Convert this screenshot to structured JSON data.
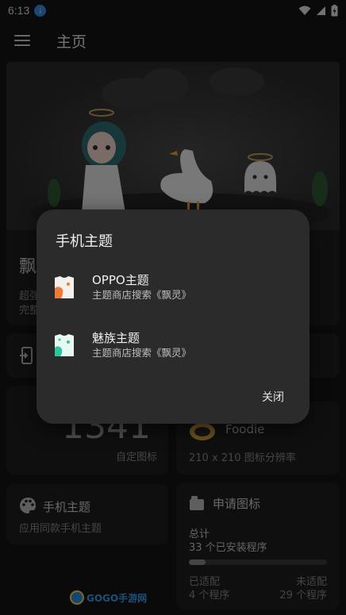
{
  "status": {
    "time": "6:13"
  },
  "appbar": {
    "title": "主页"
  },
  "bg": {
    "title_partial": "飘",
    "desc_line1": "超强",
    "desc_line2": "完整",
    "icon_count_partial": "1341",
    "icon_count_label": "自定图标",
    "foodie_name": "Foodie",
    "foodie_sub": "210 x 210 图标分辨率",
    "theme_card_title": "手机主题",
    "theme_card_sub": "应用同款手机主题",
    "request_card_title": "申请图标",
    "total_label": "总计",
    "total_value": "33 个已安装程序",
    "progress_fraction": 0.12,
    "adapted_label": "已适配",
    "adapted_value": "4 个程序",
    "unadapted_label": "未适配",
    "unadapted_value": "29 个程序",
    "watermark": "GOGO手游网"
  },
  "dialog": {
    "title": "手机主题",
    "items": [
      {
        "name": "OPPO主题",
        "sub": "主题商店搜索《飘灵》",
        "icon": "oppo-theme-icon",
        "accent": "#f07a3a"
      },
      {
        "name": "魅族主题",
        "sub": "主题商店搜索《飘灵》",
        "icon": "meizu-theme-icon",
        "accent": "#2ec4a0"
      }
    ],
    "close_label": "关闭"
  }
}
